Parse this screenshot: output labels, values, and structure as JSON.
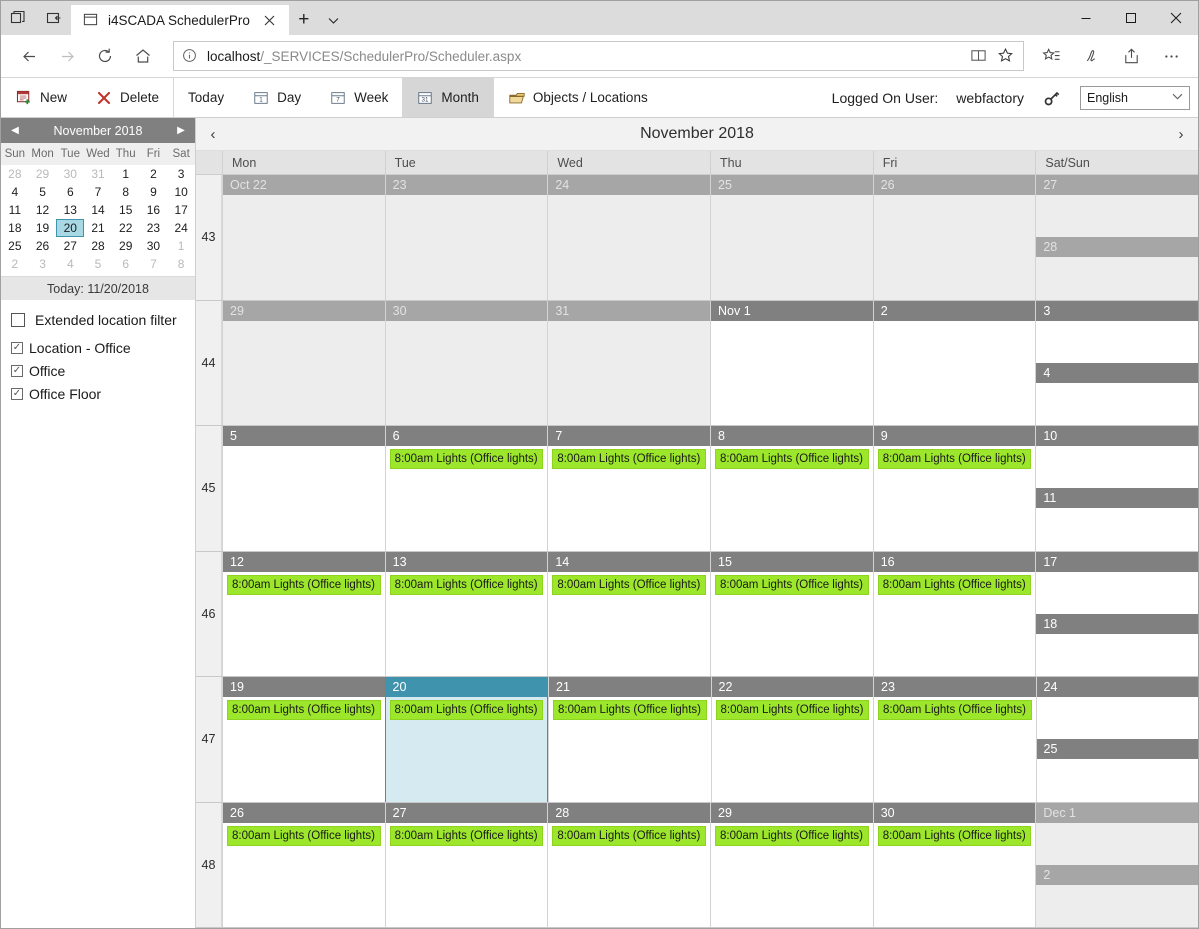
{
  "browser": {
    "tab": {
      "title": "i4SCADA SchedulerPro",
      "favicon_icon": "page-icon",
      "close_icon": "close-icon"
    },
    "new_tab_label": "+",
    "tab_dropdown_icon": "chevron-down-icon",
    "sys_icons": [
      "window-restore-icon",
      "set-aside-tabs-icon"
    ],
    "window_controls": {
      "minimize": "minimize-icon",
      "maximize": "maximize-icon",
      "close": "close-icon"
    },
    "nav": {
      "back_icon": "back-arrow-icon",
      "forward_icon": "forward-arrow-icon",
      "refresh_icon": "refresh-icon",
      "home_icon": "home-icon",
      "favorites_icon": "favorites-star-icon",
      "notes_icon": "web-notes-pen-icon",
      "share_icon": "share-icon",
      "more_icon": "more-ellipsis-icon"
    },
    "url": {
      "info_icon": "info-circle-icon",
      "host": "localhost",
      "path": "/_SERVICES/SchedulerPro/Scheduler.aspx",
      "reading_view_icon": "book-icon",
      "star_icon": "star-icon"
    }
  },
  "toolbar": {
    "new_label": "New",
    "new_icon": "calendar-add-icon",
    "delete_label": "Delete",
    "delete_icon": "red-x-icon",
    "today_label": "Today",
    "day_label": "Day",
    "day_icon": "calendar-1-icon",
    "week_label": "Week",
    "week_icon": "calendar-7-icon",
    "month_label": "Month",
    "month_icon": "calendar-31-icon",
    "objects_label": "Objects / Locations",
    "objects_icon": "folder-stack-icon",
    "logged_on_label": "Logged On User:",
    "username": "webfactory",
    "key_icon": "key-icon",
    "language": "English",
    "language_chevron": "chevron-down-icon"
  },
  "sidebar": {
    "mini_calendar": {
      "prev_icon": "triangle-left-icon",
      "title": "November 2018",
      "next_icon": "triangle-right-icon",
      "dow": [
        "Sun",
        "Mon",
        "Tue",
        "Wed",
        "Thu",
        "Fri",
        "Sat"
      ],
      "days": [
        {
          "d": "28",
          "state": "out"
        },
        {
          "d": "29",
          "state": "out"
        },
        {
          "d": "30",
          "state": "out"
        },
        {
          "d": "31",
          "state": "out"
        },
        {
          "d": "1",
          "state": "in"
        },
        {
          "d": "2",
          "state": "in"
        },
        {
          "d": "3",
          "state": "in"
        },
        {
          "d": "4",
          "state": "in"
        },
        {
          "d": "5",
          "state": "in"
        },
        {
          "d": "6",
          "state": "in"
        },
        {
          "d": "7",
          "state": "in"
        },
        {
          "d": "8",
          "state": "in"
        },
        {
          "d": "9",
          "state": "in"
        },
        {
          "d": "10",
          "state": "in"
        },
        {
          "d": "11",
          "state": "in"
        },
        {
          "d": "12",
          "state": "in"
        },
        {
          "d": "13",
          "state": "in"
        },
        {
          "d": "14",
          "state": "in"
        },
        {
          "d": "15",
          "state": "in"
        },
        {
          "d": "16",
          "state": "in"
        },
        {
          "d": "17",
          "state": "in"
        },
        {
          "d": "18",
          "state": "in"
        },
        {
          "d": "19",
          "state": "in"
        },
        {
          "d": "20",
          "state": "today"
        },
        {
          "d": "21",
          "state": "in"
        },
        {
          "d": "22",
          "state": "in"
        },
        {
          "d": "23",
          "state": "in"
        },
        {
          "d": "24",
          "state": "in"
        },
        {
          "d": "25",
          "state": "in"
        },
        {
          "d": "26",
          "state": "in"
        },
        {
          "d": "27",
          "state": "in"
        },
        {
          "d": "28",
          "state": "in"
        },
        {
          "d": "29",
          "state": "in"
        },
        {
          "d": "30",
          "state": "in"
        },
        {
          "d": "1",
          "state": "out"
        },
        {
          "d": "2",
          "state": "out"
        },
        {
          "d": "3",
          "state": "out"
        },
        {
          "d": "4",
          "state": "out"
        },
        {
          "d": "5",
          "state": "out"
        },
        {
          "d": "6",
          "state": "out"
        },
        {
          "d": "7",
          "state": "out"
        },
        {
          "d": "8",
          "state": "out"
        }
      ],
      "today_label": "Today: 11/20/2018"
    },
    "filters": {
      "extended_label": "Extended location filter",
      "extended_checked": false,
      "items": [
        {
          "label": "Location - Office",
          "checked": true
        },
        {
          "label": "Office",
          "checked": true
        },
        {
          "label": "Office Floor",
          "checked": true
        }
      ],
      "check_glyph": "✓"
    }
  },
  "calendar": {
    "prev_icon": "chevron-left-icon",
    "title": "November 2018",
    "next_icon": "chevron-right-icon",
    "day_headers": [
      "Mon",
      "Tue",
      "Wed",
      "Thu",
      "Fri",
      "Sat/Sun"
    ],
    "event_text": "8:00am Lights (Office lights)",
    "weeks": [
      {
        "num": "43",
        "days": [
          {
            "label": "Oct 22",
            "other": true,
            "events": []
          },
          {
            "label": "23",
            "other": true,
            "events": []
          },
          {
            "label": "24",
            "other": true,
            "events": []
          },
          {
            "label": "25",
            "other": true,
            "events": []
          },
          {
            "label": "26",
            "other": true,
            "events": []
          }
        ],
        "sat": {
          "label": "27",
          "other": true,
          "events": []
        },
        "sun": {
          "label": "28",
          "other": true,
          "events": []
        }
      },
      {
        "num": "44",
        "days": [
          {
            "label": "29",
            "other": true,
            "events": []
          },
          {
            "label": "30",
            "other": true,
            "events": []
          },
          {
            "label": "31",
            "other": true,
            "events": []
          },
          {
            "label": "Nov 1",
            "other": false,
            "events": []
          },
          {
            "label": "2",
            "other": false,
            "events": []
          }
        ],
        "sat": {
          "label": "3",
          "other": false,
          "events": []
        },
        "sun": {
          "label": "4",
          "other": false,
          "events": []
        }
      },
      {
        "num": "45",
        "days": [
          {
            "label": "5",
            "other": false,
            "events": []
          },
          {
            "label": "6",
            "other": false,
            "events": [
              "8:00am Lights (Office lights)"
            ]
          },
          {
            "label": "7",
            "other": false,
            "events": [
              "8:00am Lights (Office lights)"
            ]
          },
          {
            "label": "8",
            "other": false,
            "events": [
              "8:00am Lights (Office lights)"
            ]
          },
          {
            "label": "9",
            "other": false,
            "events": [
              "8:00am Lights (Office lights)"
            ]
          }
        ],
        "sat": {
          "label": "10",
          "other": false,
          "events": []
        },
        "sun": {
          "label": "11",
          "other": false,
          "events": []
        }
      },
      {
        "num": "46",
        "days": [
          {
            "label": "12",
            "other": false,
            "events": [
              "8:00am Lights (Office lights)"
            ]
          },
          {
            "label": "13",
            "other": false,
            "events": [
              "8:00am Lights (Office lights)"
            ]
          },
          {
            "label": "14",
            "other": false,
            "events": [
              "8:00am Lights (Office lights)"
            ]
          },
          {
            "label": "15",
            "other": false,
            "events": [
              "8:00am Lights (Office lights)"
            ]
          },
          {
            "label": "16",
            "other": false,
            "events": [
              "8:00am Lights (Office lights)"
            ]
          }
        ],
        "sat": {
          "label": "17",
          "other": false,
          "events": []
        },
        "sun": {
          "label": "18",
          "other": false,
          "events": []
        }
      },
      {
        "num": "47",
        "days": [
          {
            "label": "19",
            "other": false,
            "events": [
              "8:00am Lights (Office lights)"
            ]
          },
          {
            "label": "20",
            "other": false,
            "selected": true,
            "events": [
              "8:00am Lights (Office lights)"
            ]
          },
          {
            "label": "21",
            "other": false,
            "events": [
              "8:00am Lights (Office lights)"
            ]
          },
          {
            "label": "22",
            "other": false,
            "events": [
              "8:00am Lights (Office lights)"
            ]
          },
          {
            "label": "23",
            "other": false,
            "events": [
              "8:00am Lights (Office lights)"
            ]
          }
        ],
        "sat": {
          "label": "24",
          "other": false,
          "events": []
        },
        "sun": {
          "label": "25",
          "other": false,
          "events": []
        }
      },
      {
        "num": "48",
        "days": [
          {
            "label": "26",
            "other": false,
            "events": [
              "8:00am Lights (Office lights)"
            ]
          },
          {
            "label": "27",
            "other": false,
            "events": [
              "8:00am Lights (Office lights)"
            ]
          },
          {
            "label": "28",
            "other": false,
            "events": [
              "8:00am Lights (Office lights)"
            ]
          },
          {
            "label": "29",
            "other": false,
            "events": [
              "8:00am Lights (Office lights)"
            ]
          },
          {
            "label": "30",
            "other": false,
            "events": [
              "8:00am Lights (Office lights)"
            ]
          }
        ],
        "sat": {
          "label": "Dec 1",
          "other": true,
          "events": []
        },
        "sun": {
          "label": "2",
          "other": true,
          "events": []
        }
      }
    ]
  },
  "colors": {
    "event_green": "#9ce62b",
    "selected_teal": "#3f93ad",
    "selected_body": "#d6eaf2",
    "day_header_gray": "#808080",
    "other_month_header": "#a6a6a6"
  }
}
